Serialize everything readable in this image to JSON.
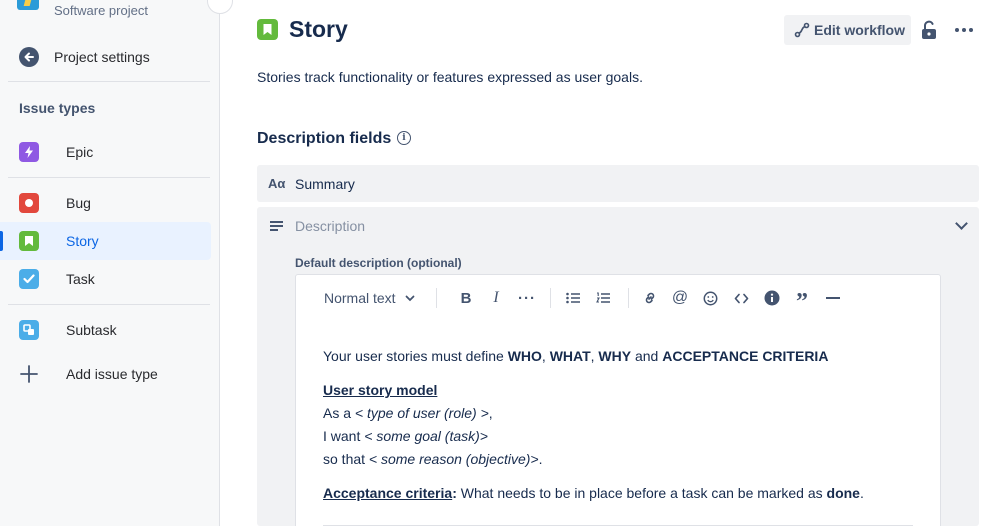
{
  "sidebar": {
    "project_subtitle": "Software project",
    "back_label": "Project settings",
    "section_heading": "Issue types",
    "items": [
      {
        "label": "Epic",
        "color": "#8f59e3"
      },
      {
        "label": "Bug",
        "color": "#e2483d"
      },
      {
        "label": "Story",
        "color": "#63ba3c"
      },
      {
        "label": "Task",
        "color": "#4bade8"
      },
      {
        "label": "Subtask",
        "color": "#4bade8"
      }
    ],
    "add_label": "Add issue type",
    "selected": "Story"
  },
  "header": {
    "title": "Story",
    "edit_workflow_label": "Edit workflow",
    "description": "Stories track functionality or features expressed as user goals."
  },
  "fields": {
    "section_title": "Description fields",
    "summary_label": "Summary",
    "description_placeholder": "Description",
    "default_description_label": "Default description (optional)"
  },
  "editor": {
    "text_style": "Normal text",
    "content": {
      "intro_prefix": "Your user stories must define ",
      "who": "WHO",
      "comma1": ", ",
      "what": "WHAT",
      "comma2": ", ",
      "why": "WHY",
      "and": " and ",
      "criteria": "ACCEPTANCE CRITERIA",
      "model_heading": "User story model",
      "line1_prefix": "As a ",
      "line1_italic": "< type of user (role) >",
      "line1_suffix": ",",
      "line2_prefix": "I want ",
      "line2_italic": "< some goal (task)>",
      "line3_prefix": "so that ",
      "line3_italic": "< some reason (objective)>",
      "line3_suffix": ".",
      "ac_heading": "Acceptance criteria",
      "ac_colon": ":",
      "ac_text": " What needs to be in place before a task can be marked as ",
      "ac_done": "done",
      "ac_period": "."
    }
  },
  "colors": {
    "accent": "#0c66e4",
    "selected_bg": "#e9f2ff",
    "story": "#63ba3c"
  }
}
